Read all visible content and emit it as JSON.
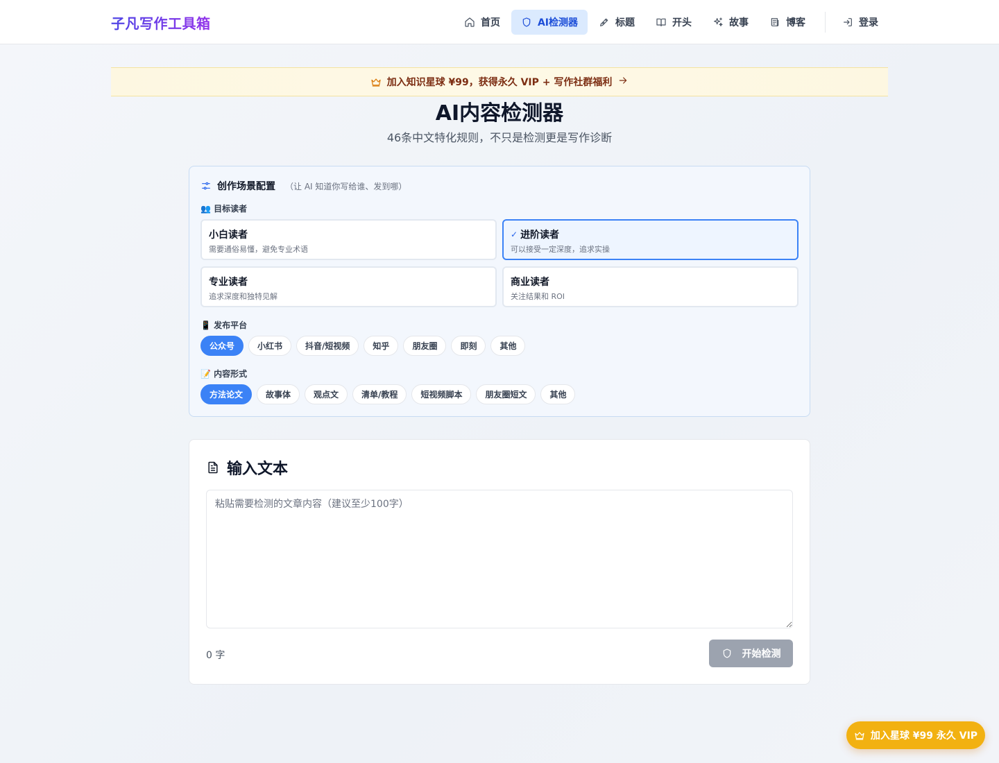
{
  "brand": "子凡写作工具箱",
  "nav": {
    "items": [
      {
        "label": "首页",
        "icon": "home-icon"
      },
      {
        "label": "AI检测器",
        "icon": "shield-icon",
        "active": true
      },
      {
        "label": "标题",
        "icon": "pen-icon"
      },
      {
        "label": "开头",
        "icon": "book-icon"
      },
      {
        "label": "故事",
        "icon": "sparkles-icon"
      },
      {
        "label": "博客",
        "icon": "newspaper-icon"
      }
    ],
    "login": "登录"
  },
  "promo": {
    "text": "加入知识星球 ¥99，获得永久 VIP + 写作社群福利"
  },
  "hero": {
    "title": "AI内容检测器",
    "subtitle": "46条中文特化规则，不只是检测更是写作诊断"
  },
  "config": {
    "title": "创作场景配置",
    "hint": "（让 AI 知道你写给谁、发到哪）",
    "readers_label": "👥 目标读者",
    "readers": [
      {
        "name": "小白读者",
        "desc": "需要通俗易懂，避免专业术语",
        "selected": false
      },
      {
        "name": "进阶读者",
        "desc": "可以接受一定深度，追求实操",
        "selected": true
      },
      {
        "name": "专业读者",
        "desc": "追求深度和独特见解",
        "selected": false
      },
      {
        "name": "商业读者",
        "desc": "关注结果和 ROI",
        "selected": false
      }
    ],
    "platform_label": "📱 发布平台",
    "platforms": [
      "公众号",
      "小红书",
      "抖音/短视频",
      "知乎",
      "朋友圈",
      "即刻",
      "其他"
    ],
    "platform_selected": "公众号",
    "format_label": "📝 内容形式",
    "formats": [
      "方法论文",
      "故事体",
      "观点文",
      "清单/教程",
      "短视频脚本",
      "朋友圈短文",
      "其他"
    ],
    "format_selected": "方法论文"
  },
  "input": {
    "title": "输入文本",
    "placeholder": "粘贴需要检测的文章内容（建议至少100字）",
    "value": "",
    "counter": "0 字",
    "start_label": "开始检测"
  },
  "fab": {
    "label": "加入星球 ¥99 永久 VIP"
  },
  "colors": {
    "accent": "#3b82f6",
    "vip": "#f2b111",
    "brand_from": "#4f46e5",
    "brand_to": "#9333ea"
  }
}
